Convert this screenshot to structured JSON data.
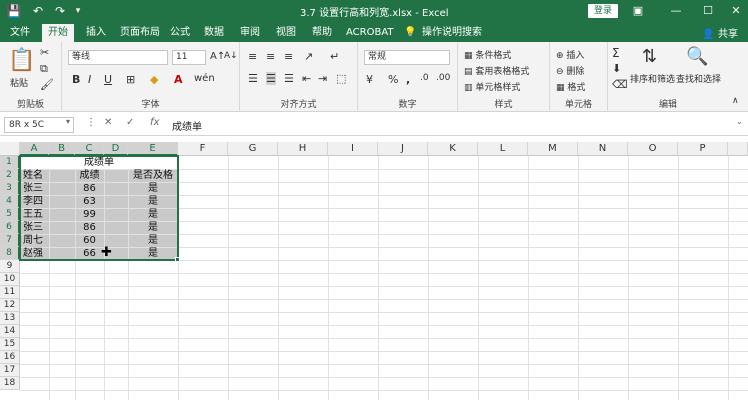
{
  "titlebar": {
    "title": "3.7 设置行高和列宽.xlsx  -  Excel",
    "login": "登录",
    "save_icon": "save-icon",
    "undo_icon": "undo-icon",
    "redo_icon": "redo-icon",
    "customize_icon": "customize-qat-icon"
  },
  "tabs": [
    "文件",
    "开始",
    "插入",
    "页面布局",
    "公式",
    "数据",
    "审阅",
    "视图",
    "帮助",
    "ACROBAT"
  ],
  "tell_me": "操作说明搜索",
  "share": "共享",
  "ribbon": {
    "clipboard": {
      "paste": "粘贴",
      "label": "剪贴板"
    },
    "font": {
      "name": "等线",
      "size": "11",
      "label": "字体",
      "bold": "B",
      "italic": "I",
      "underline": "U"
    },
    "alignment": {
      "label": "对齐方式"
    },
    "number": {
      "format": "常规",
      "percent": "%",
      "comma": ",",
      "label": "数字"
    },
    "styles": {
      "conditional": "条件格式",
      "table": "套用表格格式",
      "cell": "单元格样式",
      "label": "样式"
    },
    "cells": {
      "insert": "插入",
      "delete": "删除",
      "format": "格式",
      "label": "单元格"
    },
    "editing": {
      "sort": "排序和筛选",
      "find": "查找和选择",
      "label": "编辑"
    }
  },
  "formula_bar": {
    "name_box": "8R x 5C",
    "formula": "成绩单"
  },
  "columns": [
    "A",
    "B",
    "C",
    "D",
    "E",
    "F",
    "G",
    "H",
    "I",
    "J",
    "K",
    "L",
    "M",
    "N",
    "O",
    "P"
  ],
  "rows": [
    "1",
    "2",
    "3",
    "4",
    "5",
    "6",
    "7",
    "8",
    "9",
    "10",
    "11",
    "12",
    "13",
    "14",
    "15",
    "16",
    "17",
    "18"
  ],
  "sheet": {
    "title": "成绩单",
    "headers": {
      "name": "姓名",
      "score": "成绩",
      "pass": "是否及格"
    },
    "records": [
      {
        "name": "张三",
        "score": "86",
        "pass": "是"
      },
      {
        "name": "李四",
        "score": "63",
        "pass": "是"
      },
      {
        "name": "王五",
        "score": "99",
        "pass": "是"
      },
      {
        "name": "张三",
        "score": "86",
        "pass": "是"
      },
      {
        "name": "周七",
        "score": "60",
        "pass": "是"
      },
      {
        "name": "赵强",
        "score": "66",
        "pass": "是"
      }
    ]
  }
}
